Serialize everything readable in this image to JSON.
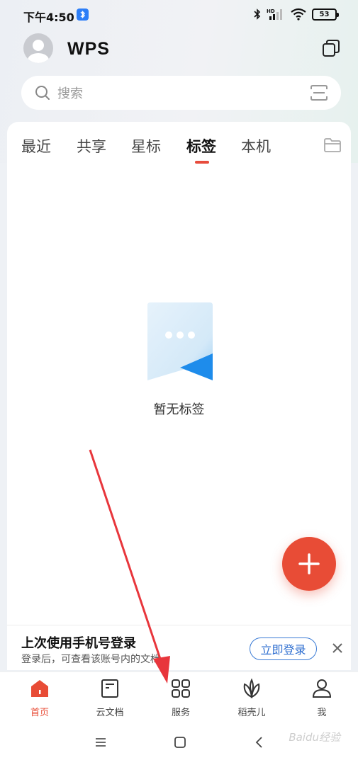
{
  "status_bar": {
    "time": "下午4:50",
    "battery": "53"
  },
  "app": {
    "brand": "WPS"
  },
  "search": {
    "placeholder": "搜索"
  },
  "tabs": [
    {
      "label": "最近"
    },
    {
      "label": "共享"
    },
    {
      "label": "星标"
    },
    {
      "label": "标签",
      "active": true
    },
    {
      "label": "本机"
    }
  ],
  "empty_state": {
    "text": "暂无标签"
  },
  "login_banner": {
    "title": "上次使用手机号登录",
    "subtitle": "登录后，可查看该账号内的文档",
    "button": "立即登录"
  },
  "bottom_nav": [
    {
      "label": "首页",
      "icon": "home-icon",
      "active": true
    },
    {
      "label": "云文档",
      "icon": "cloud-doc-icon"
    },
    {
      "label": "服务",
      "icon": "grid-icon"
    },
    {
      "label": "稻壳儿",
      "icon": "leaf-icon"
    },
    {
      "label": "我",
      "icon": "user-icon"
    }
  ],
  "watermark": "Baidu经验",
  "colors": {
    "accent": "#e84c36",
    "link": "#2f6fd0",
    "annotation_arrow": "#e8363c"
  }
}
